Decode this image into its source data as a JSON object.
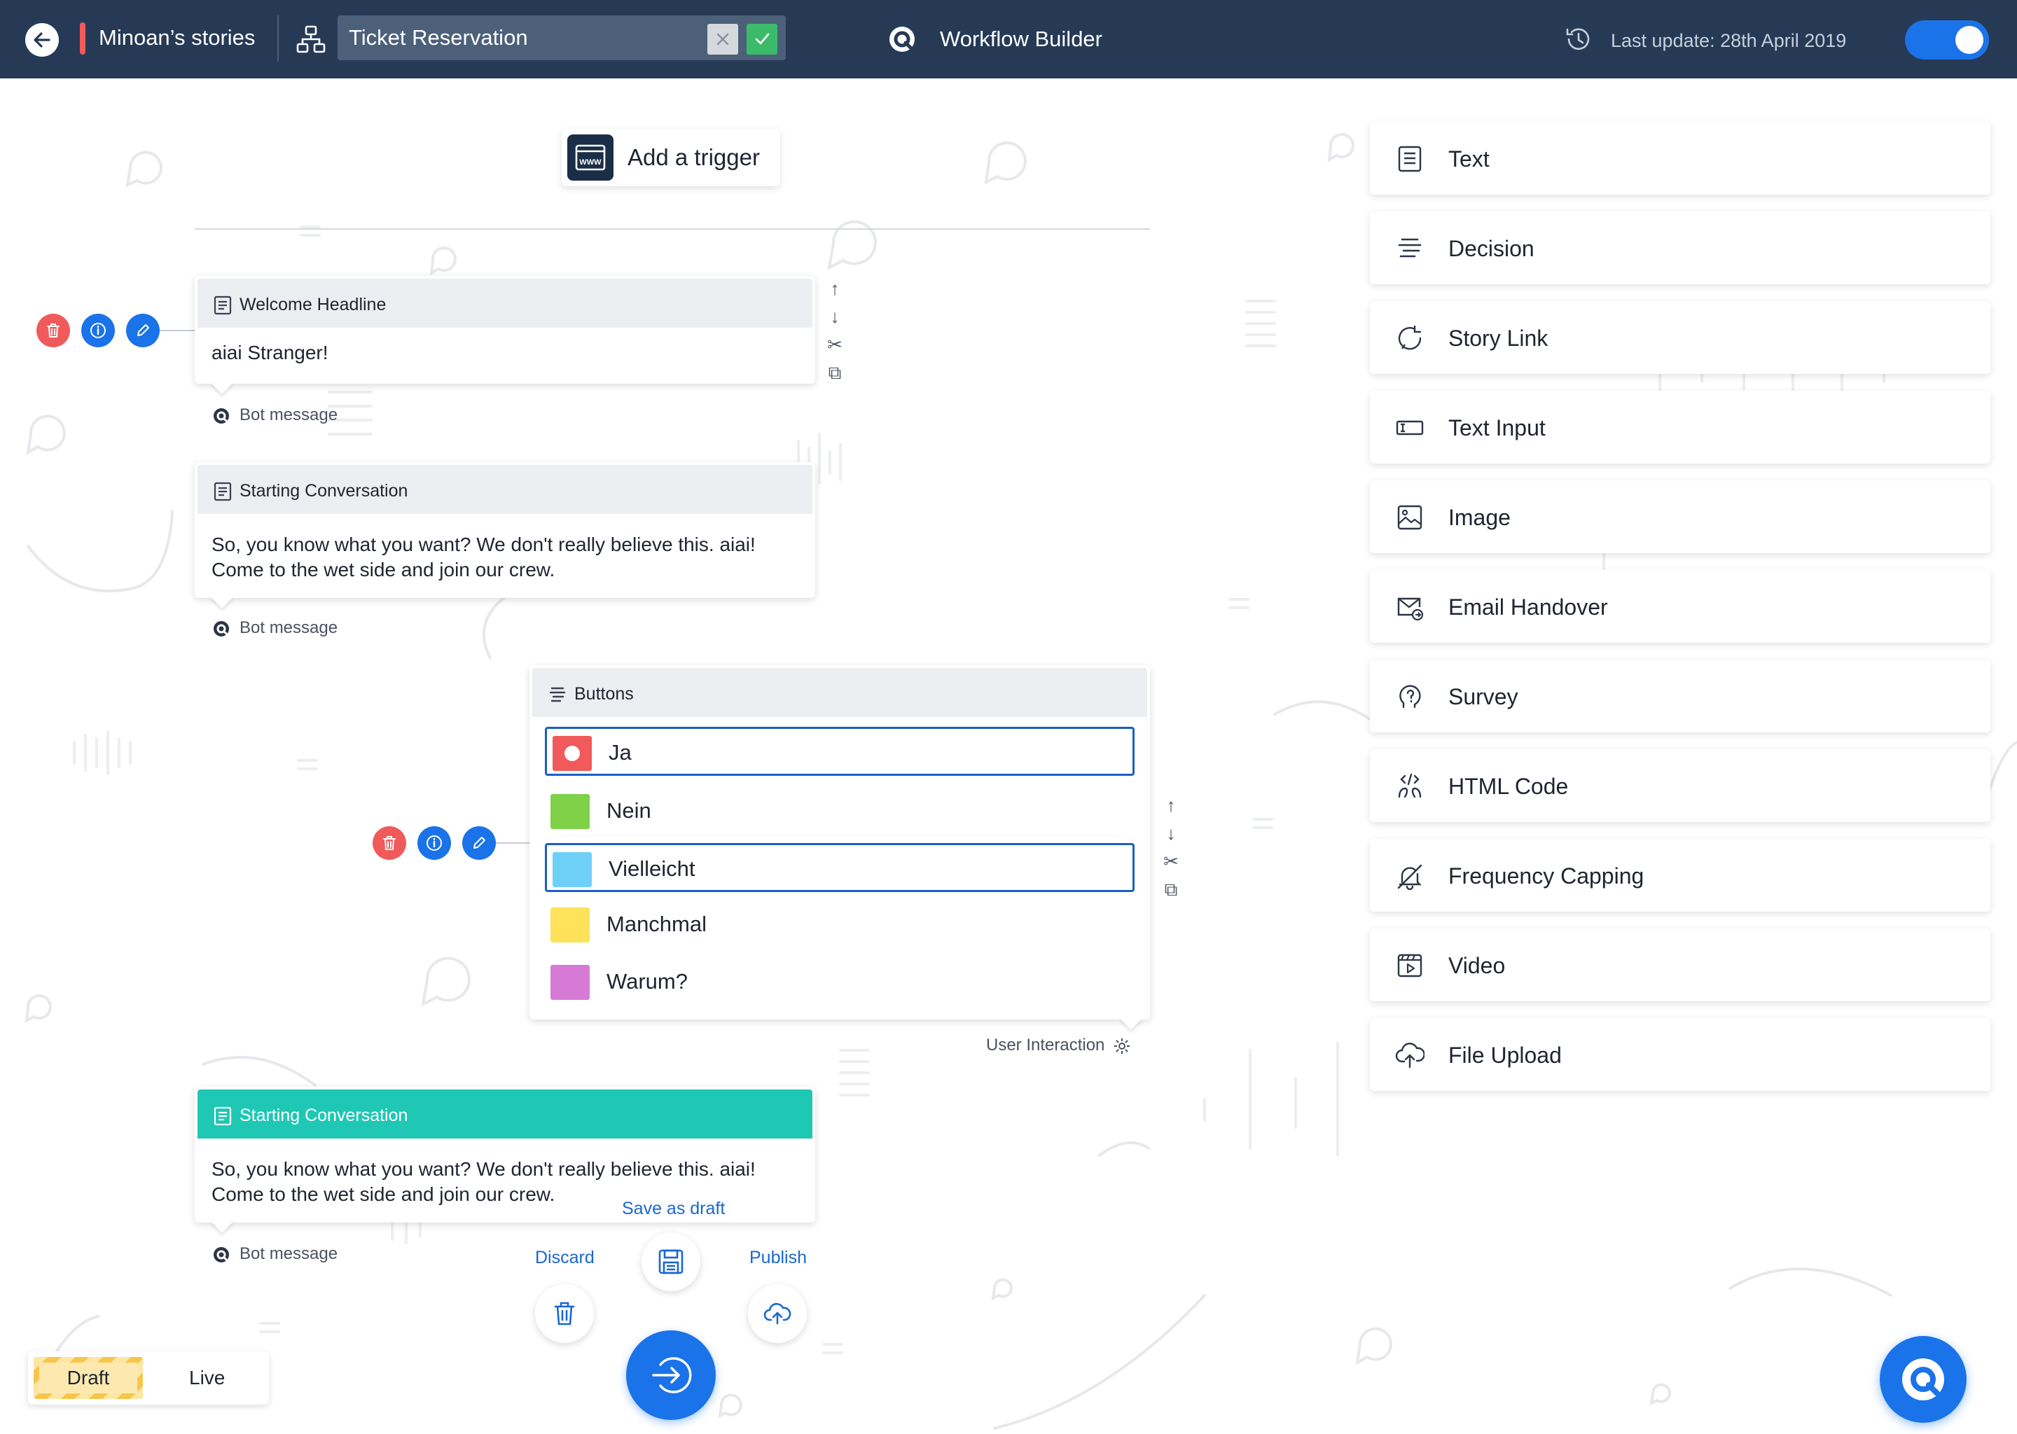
{
  "header": {
    "story_name": "Minoan’s stories",
    "ticket_value": "Ticket Reservation",
    "app_title": "Workflow Builder",
    "last_update": "Last update: 28th April 2019",
    "toggle_on": true
  },
  "canvas": {
    "trigger_label": "Add a trigger",
    "cards": [
      {
        "title": "Welcome Headline",
        "body": [
          "aiai Stranger!"
        ],
        "tag": "Bot message"
      },
      {
        "title": "Starting Conversation",
        "body": [
          "So, you know what you want? We don't really believe this. aiai!",
          "Come to the wet side and join our crew."
        ],
        "tag": "Bot message"
      }
    ],
    "buttons_card": {
      "title": "Buttons",
      "options": [
        {
          "label": "Ja",
          "color": "#f05a5a",
          "selected": true
        },
        {
          "label": "Nein",
          "color": "#7fd147",
          "selected": false
        },
        {
          "label": "Vielleicht",
          "color": "#6fd0f7",
          "selected": true
        },
        {
          "label": "Manchmal",
          "color": "#fde25a",
          "selected": false
        },
        {
          "label": "Warum?",
          "color": "#d77ad6",
          "selected": false
        }
      ],
      "tag": "User Interaction"
    },
    "edit_card": {
      "title": "Starting Conversation",
      "body": [
        "So, you know what you want? We don't really believe this. aiai!",
        "Come to the wet side and join our crew."
      ],
      "tag": "Bot message",
      "save_draft": "Save as draft",
      "discard": "Discard",
      "publish": "Publish"
    }
  },
  "palette": [
    {
      "label": "Text",
      "icon": "text-icon"
    },
    {
      "label": "Decision",
      "icon": "decision-icon"
    },
    {
      "label": "Story Link",
      "icon": "story-link-icon"
    },
    {
      "label": "Text Input",
      "icon": "text-input-icon"
    },
    {
      "label": "Image",
      "icon": "image-icon"
    },
    {
      "label": "Email Handover",
      "icon": "email-handover-icon"
    },
    {
      "label": "Survey",
      "icon": "survey-icon"
    },
    {
      "label": "HTML Code",
      "icon": "html-code-icon"
    },
    {
      "label": "Frequency Capping",
      "icon": "frequency-capping-icon"
    },
    {
      "label": "Video",
      "icon": "video-icon"
    },
    {
      "label": "File Upload",
      "icon": "file-upload-icon"
    }
  ],
  "mode": {
    "draft": "Draft",
    "live": "Live",
    "active": "Draft"
  }
}
